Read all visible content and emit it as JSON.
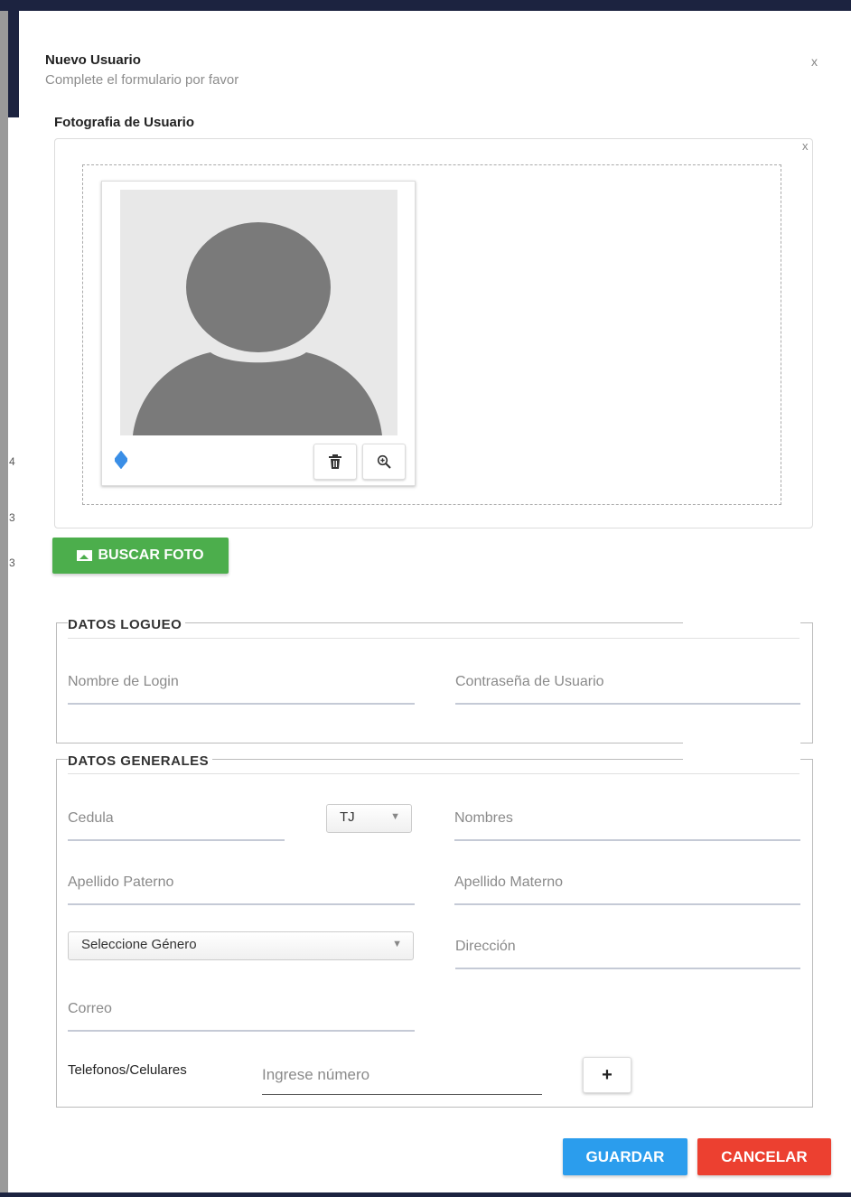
{
  "modal": {
    "title": "Nuevo Usuario",
    "subtitle": "Complete el formulario por favor",
    "close_symbol": "x"
  },
  "photo": {
    "label": "Fotografia de Usuario",
    "remove_symbol": "x",
    "drag_icon": "move-arrows-icon",
    "trash_icon": "trash-icon",
    "zoom_icon": "zoom-in-icon",
    "search_button": "BUSCAR FOTO",
    "search_icon": "image-icon"
  },
  "login_section": {
    "legend": "DATOS LOGUEO",
    "login_placeholder": "Nombre de Login",
    "password_placeholder": "Contraseña de Usuario"
  },
  "general_section": {
    "legend": "DATOS GENERALES",
    "cedula_placeholder": "Cedula",
    "expedido_value": "TJ",
    "nombres_placeholder": "Nombres",
    "apellido_paterno_placeholder": "Apellido Paterno",
    "apellido_materno_placeholder": "Apellido Materno",
    "genero_value": "Seleccione Género",
    "direccion_placeholder": "Dirección",
    "correo_placeholder": "Correo",
    "telefonos_label": "Telefonos/Celulares",
    "telefono_placeholder": "Ingrese número",
    "add_phone_symbol": "+"
  },
  "actions": {
    "save_label": "GUARDAR",
    "cancel_label": "CANCELAR"
  },
  "colors": {
    "green": "#4cae4c",
    "blue": "#2b9ded",
    "red": "#ec4030",
    "navy": "#1c2340"
  },
  "background_glyphs": [
    "4",
    "3",
    "3"
  ]
}
